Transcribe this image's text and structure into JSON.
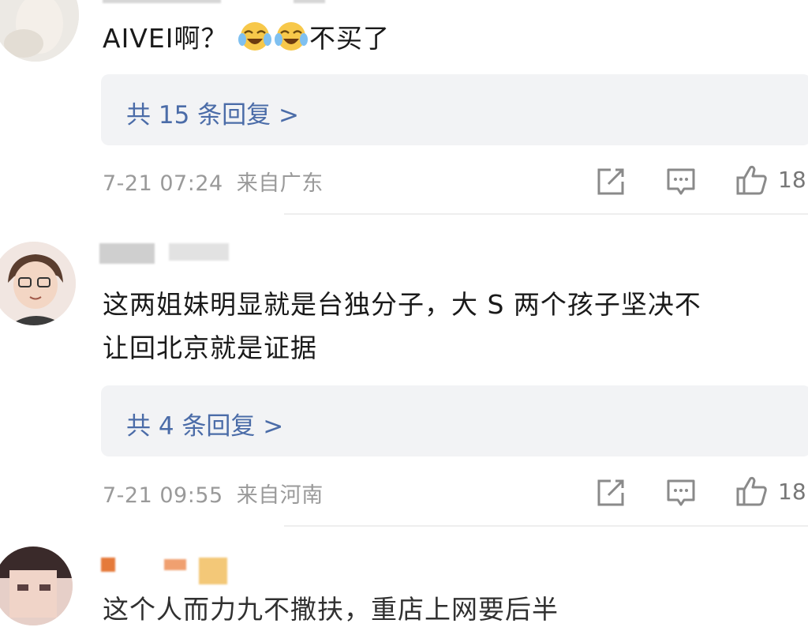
{
  "comments": [
    {
      "text_prefix": "AIVEI啊？",
      "text_suffix": "不买了",
      "emoji": "laugh-cry-emoji",
      "replies_label": "共 15 条回复 >",
      "date": "7-21 07:24",
      "location": "来自广东",
      "like_count": "18"
    },
    {
      "line1": "这两姐妹明显就是台独分子，大 S 两个孩子坚决不",
      "line2": "让回北京就是证据",
      "replies_label": "共 4 条回复 >",
      "date": "7-21 09:55",
      "location": "来自河南",
      "like_count": "18"
    },
    {
      "partial_text": "这个人而力九不撒扶，重店上网要后半"
    }
  ],
  "icons": {
    "share": "share-icon",
    "comment": "comment-icon",
    "like": "thumbs-up-icon"
  },
  "colors": {
    "link": "#4b6ca8",
    "meta": "#9a9a9a",
    "reply_bg": "#f2f3f5"
  }
}
